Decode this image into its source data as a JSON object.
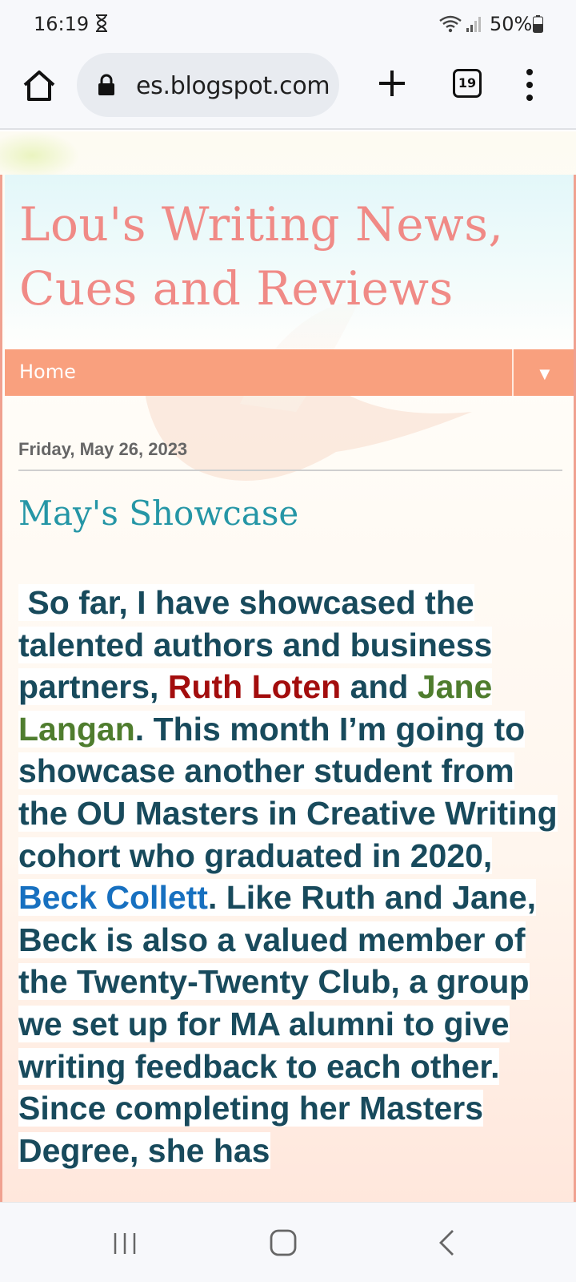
{
  "status_bar": {
    "time": "16:19",
    "battery": "50%"
  },
  "browser": {
    "url": "es.blogspot.com",
    "tab_count": "19"
  },
  "blog": {
    "title": "Lou's Writing News, Cues and Reviews",
    "nav_home": "Home",
    "nav_arrow": "▼"
  },
  "post": {
    "date": "Friday, May 26, 2023",
    "title": "May's Showcase",
    "body": {
      "p1": "So far, I have showcased the talented authors and business partners, ",
      "ruth": "Ruth Loten",
      "and": " and ",
      "jane": "Jane Langan",
      "p2": ". This month I’m going to showcase another student from the OU Masters in Creative Writing cohort who graduated in 2020, ",
      "beck": "Beck Collett",
      "p3": ". Like Ruth and Jane, Beck is also a valued member of the Twenty-Twenty Club, a group we set up for MA alumni to give writing feedback to each other. Since completing her Masters Degree, she has"
    }
  },
  "colors": {
    "title": "#f08a86",
    "nav": "#f9a07e",
    "post_title": "#2596a6",
    "body_text": "#184a5c",
    "ruth": "#a30d0d",
    "jane": "#4f7d2e",
    "beck": "#1770c0"
  },
  "icons": {
    "status": [
      "hourglass-icon",
      "wifi-icon",
      "signal-icon",
      "battery-icon"
    ],
    "toolbar": [
      "home-icon",
      "lock-icon",
      "plus-icon",
      "tabs-icon",
      "menu-icon"
    ],
    "system_nav": [
      "recent-apps-icon",
      "home-button-icon",
      "back-icon"
    ]
  }
}
